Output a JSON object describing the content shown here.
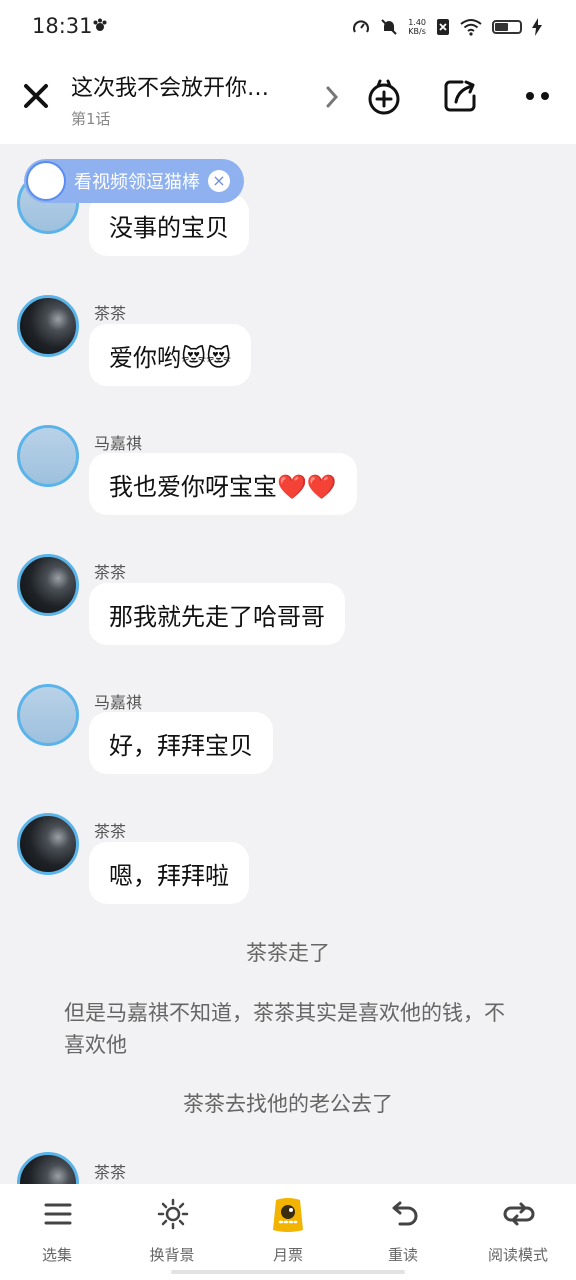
{
  "status": {
    "time": "18:31",
    "speed_value": "1.40",
    "speed_unit": "KB/s",
    "battery_level": 0.55
  },
  "header": {
    "title": "这次我不会放开你…",
    "subtitle": "第1话"
  },
  "promo": {
    "text": "看视频领逗猫棒",
    "close": "×"
  },
  "messages": [
    {
      "name": "",
      "text": "没事的宝贝"
    },
    {
      "name": "茶茶",
      "text": "爱你哟😻😻"
    },
    {
      "name": "马嘉祺",
      "text": "我也爱你呀宝宝❤️❤️"
    },
    {
      "name": "茶茶",
      "text": "那我就先走了哈哥哥"
    },
    {
      "name": "马嘉祺",
      "text": "好，拜拜宝贝"
    },
    {
      "name": "茶茶",
      "text": "嗯，拜拜啦"
    },
    {
      "name": "茶茶",
      "text": ""
    }
  ],
  "narration": [
    "茶茶走了",
    "但是马嘉祺不知道，茶茶其实是喜欢他的钱，不喜欢他",
    "茶茶去找他的老公去了"
  ],
  "tabs": [
    "选集",
    "换背景",
    "月票",
    "重读",
    "阅读模式"
  ]
}
